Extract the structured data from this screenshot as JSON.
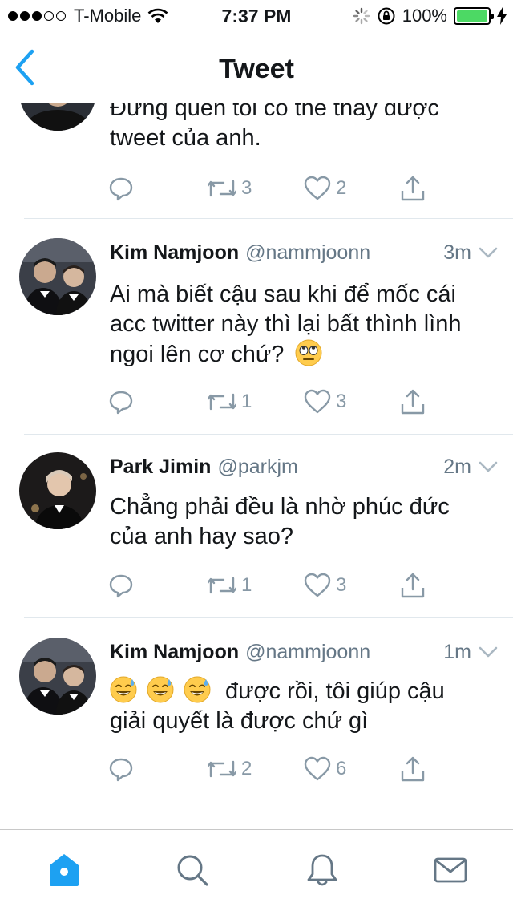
{
  "status_bar": {
    "carrier": "T-Mobile",
    "time": "7:37 PM",
    "battery": "100%"
  },
  "nav": {
    "title": "Tweet"
  },
  "partial_tweet": {
    "text_line1": "Đừng quên tôi có thể thấy được",
    "text_line2": "tweet của anh.",
    "retweets": "3",
    "likes": "2"
  },
  "tweets": [
    {
      "name": "Kim Namjoon",
      "handle": "@nammjoonn",
      "time": "3m",
      "text": "Ai mà biết cậu sau khi để mốc cái acc twitter này thì lại bất thình lình ngoi lên cơ chứ?",
      "emoji": "eye-roll-emoji",
      "retweets": "1",
      "likes": "3"
    },
    {
      "name": "Park Jimin",
      "handle": "@parkjm",
      "time": "2m",
      "text": "Chẳng phải đều là nhờ phúc đức của anh hay sao?",
      "retweets": "1",
      "likes": "3"
    },
    {
      "name": "Kim Namjoon",
      "handle": "@nammjoonn",
      "time": "1m",
      "text": "được rồi, tôi giúp cậu giải quyết là được chứ gì",
      "emoji": "sweat-smile-emoji",
      "retweets": "2",
      "likes": "6"
    }
  ],
  "tab_bar": {
    "icons": [
      "home-icon",
      "search-icon",
      "notifications-icon",
      "messages-icon"
    ],
    "active_color": "#1da1f2",
    "inactive_color": "#657786"
  },
  "colors": {
    "accent": "#1da1f2",
    "muted": "#8899a6",
    "battery": "#4cd964"
  }
}
